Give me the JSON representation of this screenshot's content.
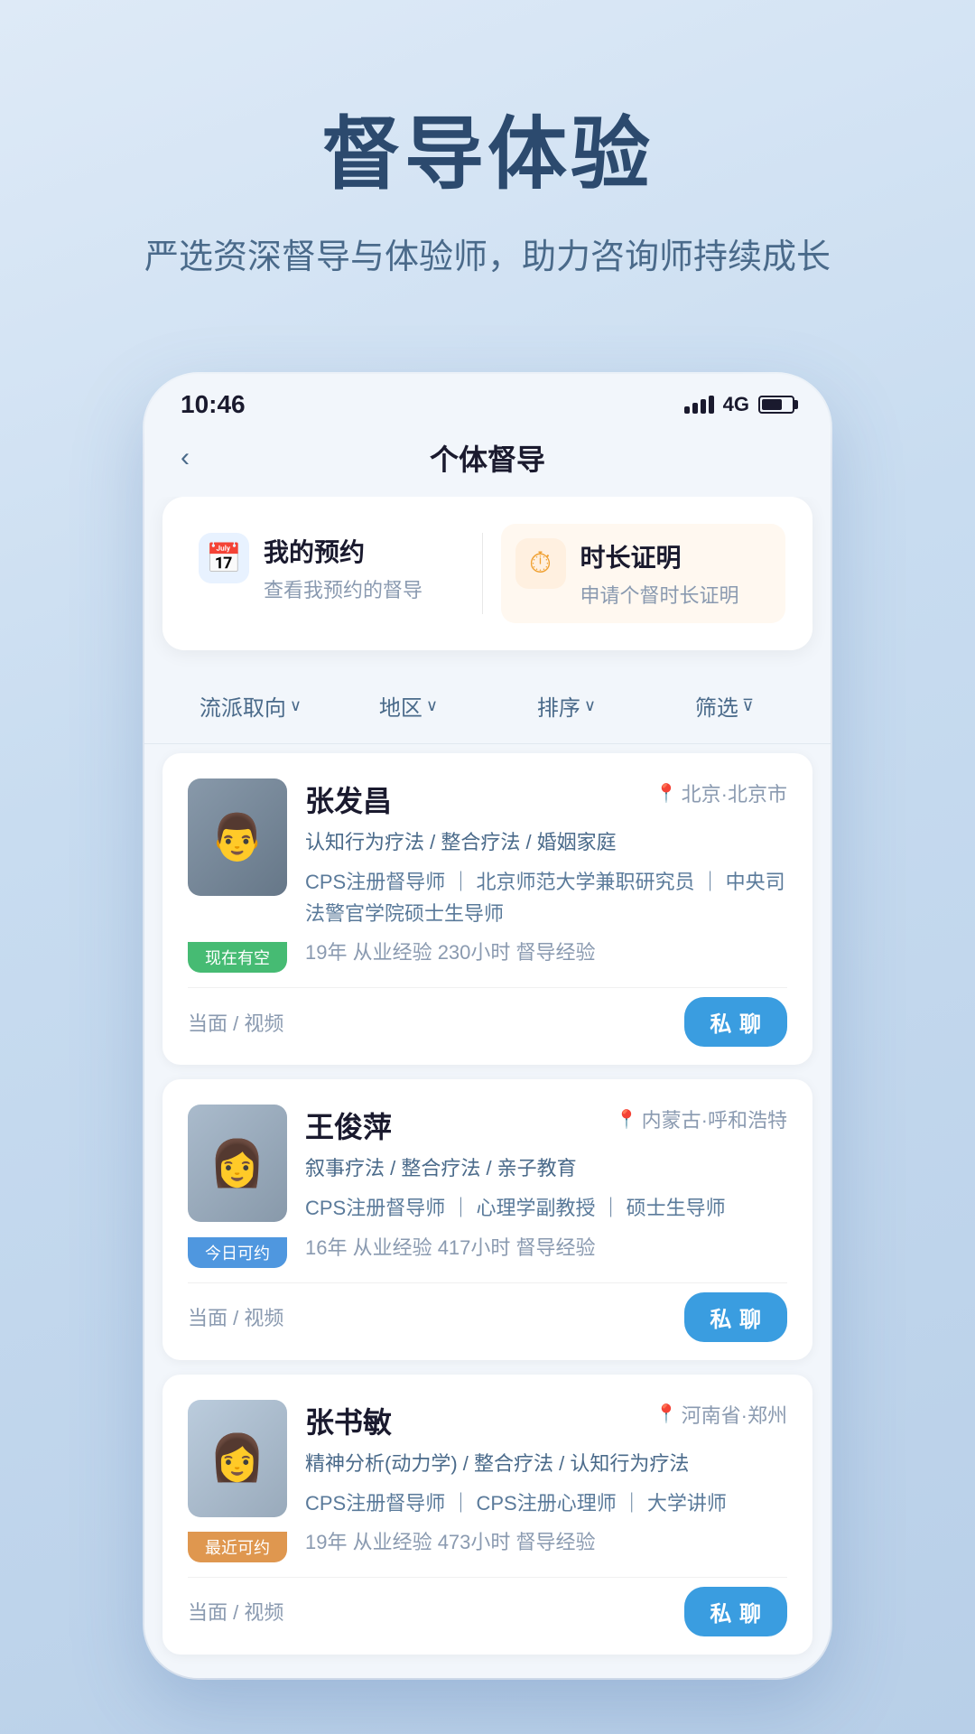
{
  "hero": {
    "title": "督导体验",
    "subtitle": "严选资深督导与体验师，助力咨询师持续成长"
  },
  "statusBar": {
    "time": "10:46",
    "signal": "4G"
  },
  "navBar": {
    "back": "‹",
    "title": "个体督导"
  },
  "cards": [
    {
      "id": "my-appointment",
      "icon": "📅",
      "iconType": "blue",
      "title": "我的预约",
      "subtitle": "查看我预约的督导"
    },
    {
      "id": "duration-cert",
      "icon": "⏰",
      "iconType": "orange",
      "title": "时长证明",
      "subtitle": "申请个督时长证明"
    }
  ],
  "filters": [
    {
      "label": "流派取向",
      "hasArrow": true
    },
    {
      "label": "地区",
      "hasArrow": true
    },
    {
      "label": "排序",
      "hasArrow": true
    },
    {
      "label": "筛选",
      "hasFilter": true
    }
  ],
  "supervisors": [
    {
      "name": "张发昌",
      "location": "北京·北京市",
      "tags": "认知行为疗法 / 整合疗法 / 婚姻家庭",
      "credentials": "CPS注册督导师 ｜ 北京师范大学兼职研究员 ｜ 中央司法警官学院硕士生导师",
      "experience": "19年 从业经验   230小时 督导经验",
      "sessionType": "当面 / 视频",
      "availability": "现在有空",
      "badgeClass": "badge-green",
      "avatarClass": "avatar-man"
    },
    {
      "name": "王俊萍",
      "location": "内蒙古·呼和浩特",
      "tags": "叙事疗法 / 整合疗法 / 亲子教育",
      "credentials": "CPS注册督导师 ｜ 心理学副教授 ｜ 硕士生导师",
      "experience": "16年 从业经验   417小时 督导经验",
      "sessionType": "当面 / 视频",
      "availability": "今日可约",
      "badgeClass": "badge-blue",
      "avatarClass": "avatar-woman1"
    },
    {
      "name": "张书敏",
      "location": "河南省·郑州",
      "tags": "精神分析(动力学) / 整合疗法 / 认知行为疗法",
      "credentials": "CPS注册督导师 ｜ CPS注册心理师 ｜ 大学讲师",
      "experience": "19年 从业经验   473小时 督导经验",
      "sessionType": "当面 / 视频",
      "availability": "最近可约",
      "badgeClass": "badge-orange",
      "avatarClass": "avatar-woman2"
    }
  ],
  "buttons": {
    "chat": "私 聊"
  }
}
